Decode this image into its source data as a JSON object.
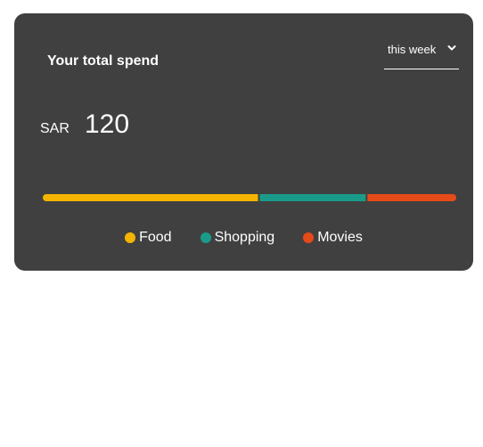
{
  "card": {
    "title": "Your total spend",
    "period": {
      "selected": "this week",
      "icon": "chevron-down-icon"
    },
    "currency": "SAR",
    "amount": "120"
  },
  "chart_data": {
    "type": "bar",
    "categories": [
      "Food",
      "Shopping",
      "Movies"
    ],
    "values": [
      63,
      31,
      26
    ],
    "colors": [
      "#F5B400",
      "#1A9B8A",
      "#E64A19"
    ],
    "legend": "bottom"
  }
}
